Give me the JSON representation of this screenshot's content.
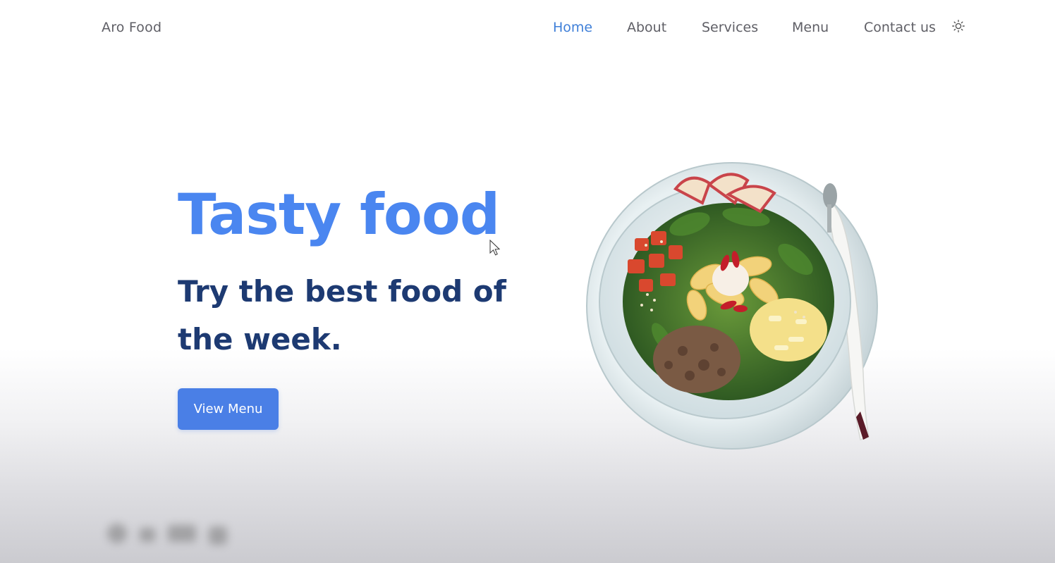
{
  "nav": {
    "logo": "Aro Food",
    "links": [
      {
        "label": "Home",
        "active": true
      },
      {
        "label": "About",
        "active": false
      },
      {
        "label": "Services",
        "active": false
      },
      {
        "label": "Menu",
        "active": false
      },
      {
        "label": "Contact us",
        "active": false
      }
    ],
    "theme_icon": "sun-icon"
  },
  "hero": {
    "title": "Tasty food",
    "subtitle": "Try the best food of the week.",
    "cta_label": "View Menu",
    "image_icon": "salad-bowl"
  },
  "colors": {
    "accent": "#4a86f0",
    "nav_active": "#3f7fd8",
    "heading_dark": "#1d3a72",
    "button": "#4a7fe6",
    "nav_text": "#5f5f66"
  }
}
